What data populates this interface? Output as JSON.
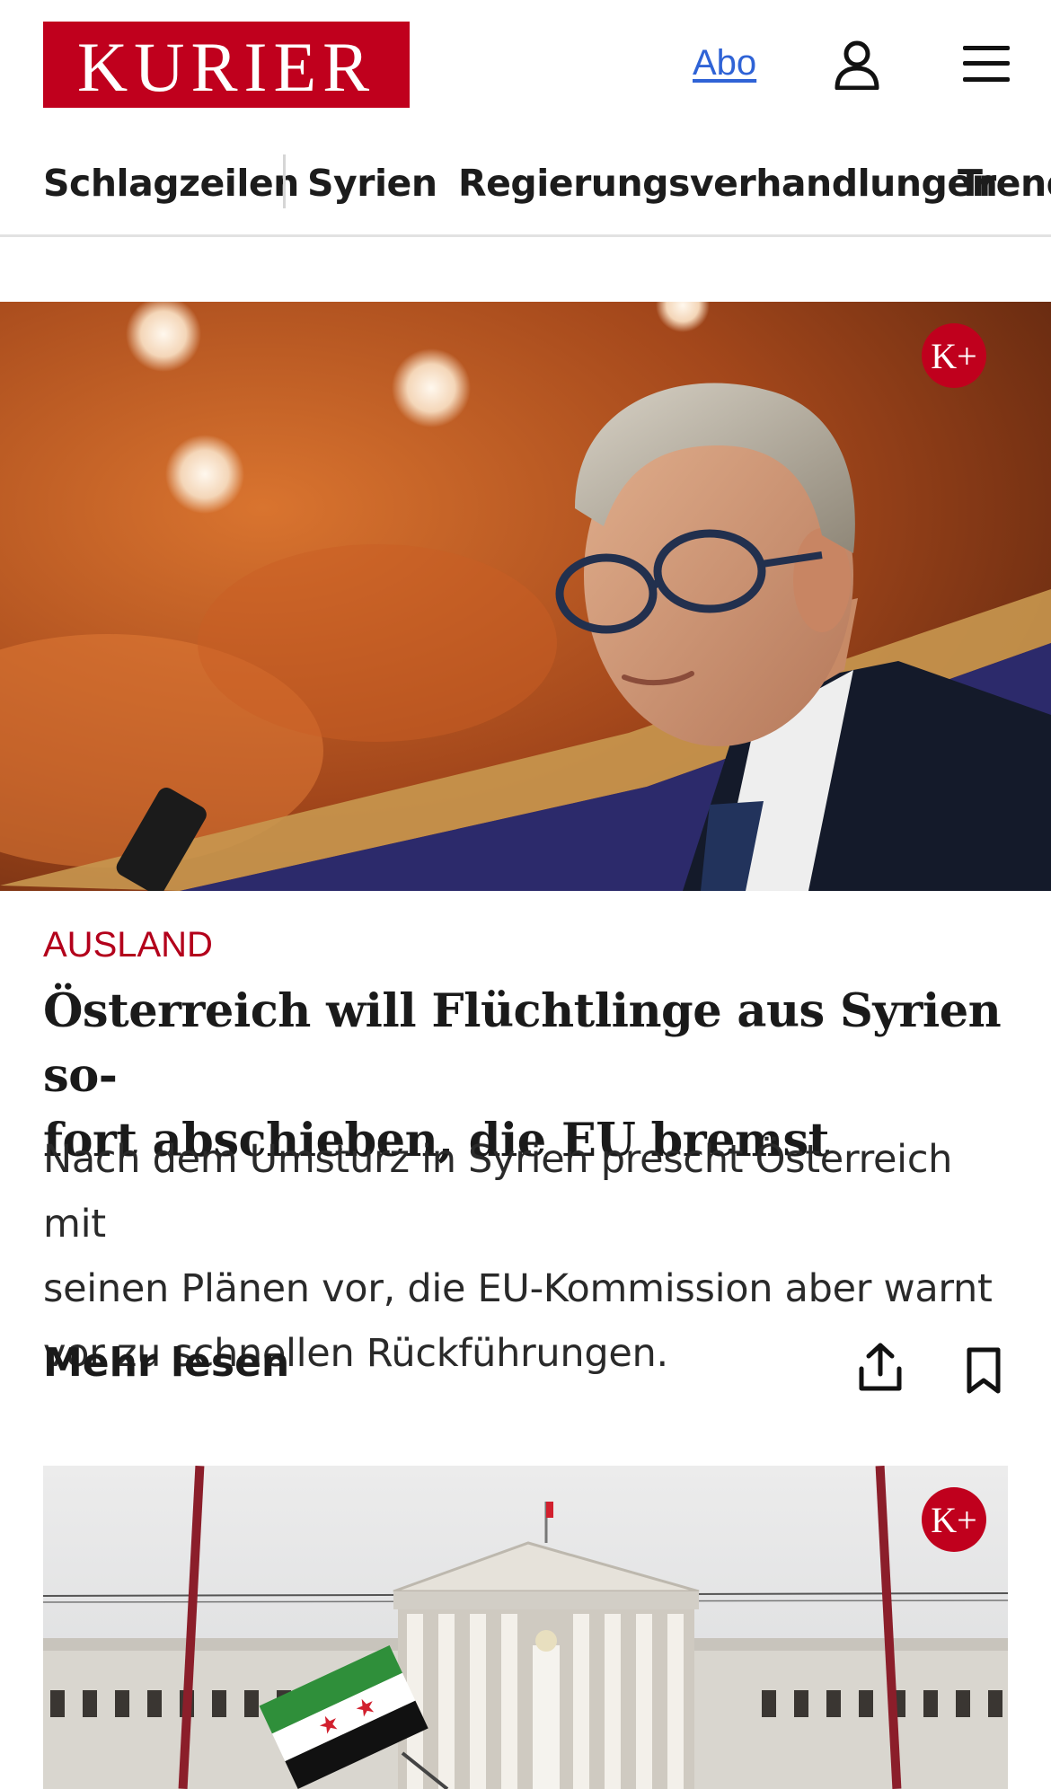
{
  "header": {
    "logo": "KURIER",
    "abo_label": "Abo",
    "icons": {
      "user": "user-icon",
      "menu": "hamburger-menu-icon"
    }
  },
  "nav": {
    "items": [
      {
        "label": "Schlagzeilen"
      },
      {
        "label": "Syrien"
      },
      {
        "label": "Regierungsverhandlungen"
      },
      {
        "label": "Trend"
      }
    ]
  },
  "article": {
    "badge": "K+",
    "kicker": "AUSLAND",
    "headline_line1": "Österreich will Flüchtlinge aus Syrien so-",
    "headline_line2": "fort abschieben, die EU bremst",
    "teaser_line1": "Nach dem Umsturz in Syrien prescht Österreich mit",
    "teaser_line2": "seinen Plänen vor, die EU-Kommission aber warnt",
    "teaser_line3": "vor zu schnellen Rückführungen.",
    "more_label": "Mehr lesen",
    "icons": {
      "share": "share-icon",
      "bookmark": "bookmark-icon"
    }
  },
  "article2": {
    "badge": "K+"
  },
  "colors": {
    "brand": "#c0001d",
    "link": "#2f63d6",
    "kicker": "#b3001b"
  }
}
